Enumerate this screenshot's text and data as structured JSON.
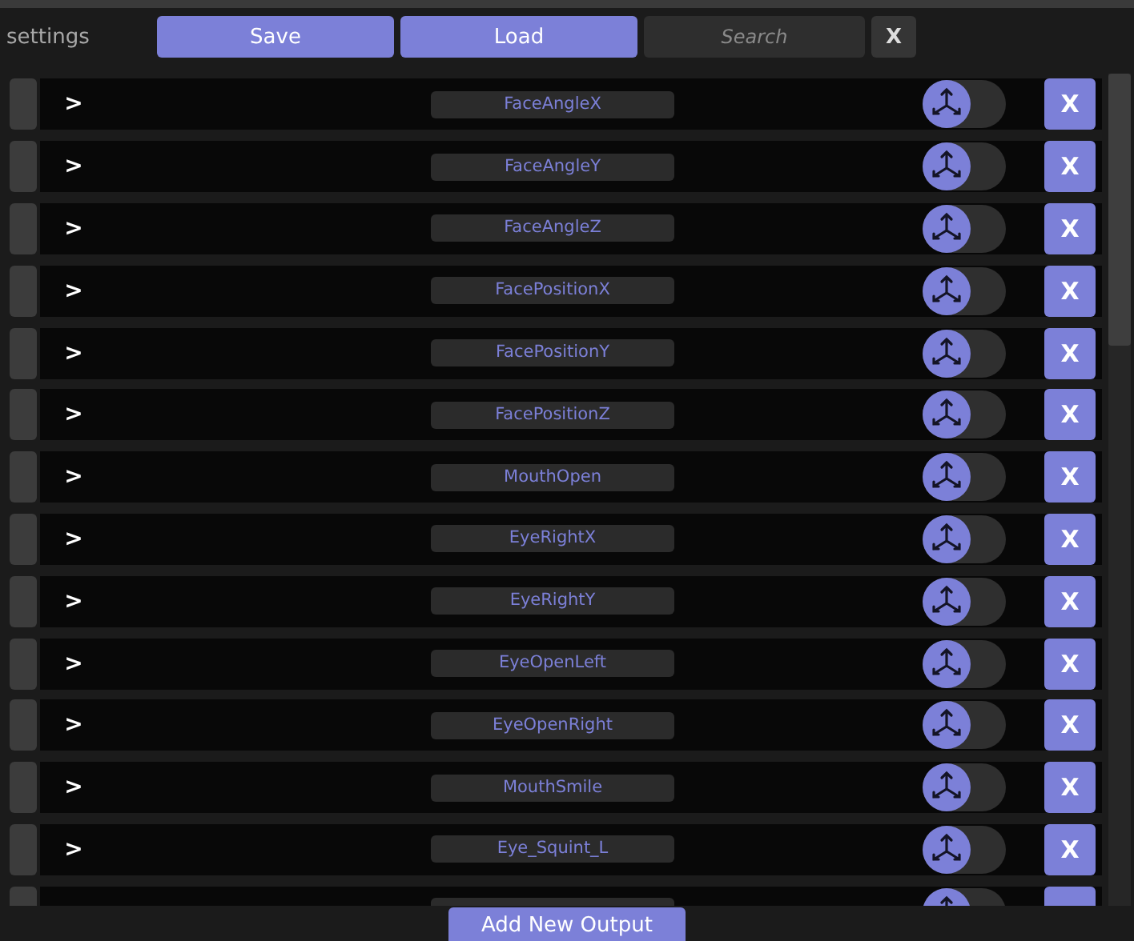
{
  "header": {
    "title": "settings",
    "buttons": [
      "Save",
      "Load"
    ],
    "search": {
      "placeholder": "Search"
    },
    "clear": "X"
  },
  "outputs": [
    {
      "expander": ">",
      "name": "FaceAngleX",
      "on": false,
      "remove": "X"
    },
    {
      "expander": ">",
      "name": "FaceAngleY",
      "on": false,
      "remove": "X"
    },
    {
      "expander": ">",
      "name": "FaceAngleZ",
      "on": false,
      "remove": "X"
    },
    {
      "expander": ">",
      "name": "FacePositionX",
      "on": false,
      "remove": "X"
    },
    {
      "expander": ">",
      "name": "FacePositionY",
      "on": false,
      "remove": "X"
    },
    {
      "expander": ">",
      "name": "FacePositionZ",
      "on": false,
      "remove": "X"
    },
    {
      "expander": ">",
      "name": "MouthOpen",
      "on": false,
      "remove": "X"
    },
    {
      "expander": ">",
      "name": "EyeRightX",
      "on": false,
      "remove": "X"
    },
    {
      "expander": ">",
      "name": "EyeRightY",
      "on": false,
      "remove": "X"
    },
    {
      "expander": ">",
      "name": "EyeOpenLeft",
      "on": false,
      "remove": "X"
    },
    {
      "expander": ">",
      "name": "EyeOpenRight",
      "on": false,
      "remove": "X"
    },
    {
      "expander": ">",
      "name": "MouthSmile",
      "on": false,
      "remove": "X"
    },
    {
      "expander": ">",
      "name": "Eye_Squint_L",
      "on": false,
      "remove": "X"
    },
    {
      "on": false
    }
  ],
  "add_button": "Add New Output"
}
